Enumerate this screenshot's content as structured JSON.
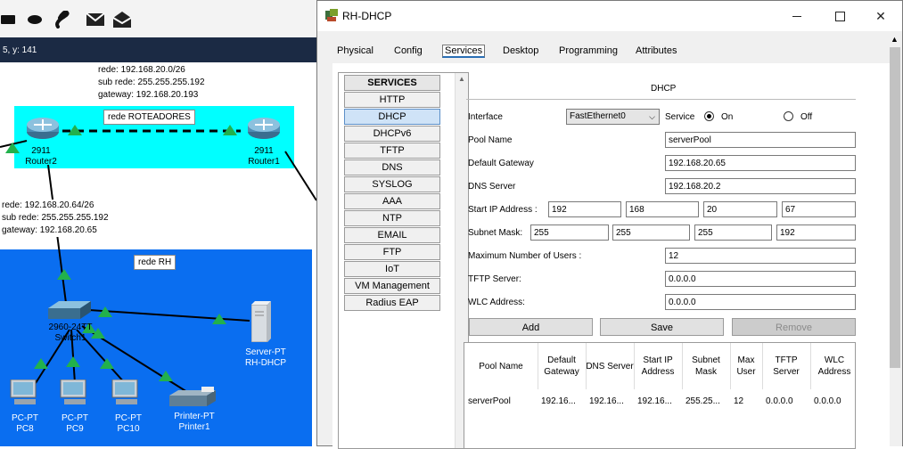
{
  "status_coords": "5, y: 141",
  "workspace": {
    "note_top": [
      "rede: 192.168.20.0/26",
      "sub rede: 255.255.255.192",
      "gateway: 192.168.20.193"
    ],
    "note_mid": [
      "rede: 192.168.20.64/26",
      "sub rede: 255.255.255.192",
      "gateway: 192.168.20.65"
    ],
    "area_routers": "rede ROTEADORES",
    "area_rh": "rede RH",
    "router2": [
      "2911",
      "Router2"
    ],
    "router1": [
      "2911",
      "Router1"
    ],
    "switch": [
      "2960-24TT",
      "Switch1"
    ],
    "server": [
      "Server-PT",
      "RH-DHCP"
    ],
    "pc8": [
      "PC-PT",
      "PC8"
    ],
    "pc9": [
      "PC-PT",
      "PC9"
    ],
    "pc10": [
      "PC-PT",
      "PC10"
    ],
    "printer": [
      "Printer-PT",
      "Printer1"
    ]
  },
  "window": {
    "title": "RH-DHCP",
    "tabs": [
      "Physical",
      "Config",
      "Services",
      "Desktop",
      "Programming",
      "Attributes"
    ],
    "active_tab": "Services"
  },
  "services": {
    "header": "SERVICES",
    "items": [
      "HTTP",
      "DHCP",
      "DHCPv6",
      "TFTP",
      "DNS",
      "SYSLOG",
      "AAA",
      "NTP",
      "EMAIL",
      "FTP",
      "IoT",
      "VM Management",
      "Radius EAP"
    ],
    "selected": "DHCP"
  },
  "dhcp": {
    "heading": "DHCP",
    "interface_label": "Interface",
    "interface_value": "FastEthernet0",
    "service_label": "Service",
    "on_label": "On",
    "off_label": "Off",
    "pool_name_label": "Pool Name",
    "pool_name_value": "serverPool",
    "default_gateway_label": "Default Gateway",
    "default_gateway_value": "192.168.20.65",
    "dns_label": "DNS Server",
    "dns_value": "192.168.20.2",
    "start_ip_label": "Start IP Address :",
    "start_ip": [
      "192",
      "168",
      "20",
      "67"
    ],
    "subnet_label": "Subnet Mask:",
    "subnet": [
      "255",
      "255",
      "255",
      "192"
    ],
    "max_users_label": "Maximum Number of Users :",
    "max_users_value": "12",
    "tftp_label": "TFTP Server:",
    "tftp_value": "0.0.0.0",
    "wlc_label": "WLC Address:",
    "wlc_value": "0.0.0.0",
    "add_label": "Add",
    "save_label": "Save",
    "remove_label": "Remove",
    "table": {
      "headers": [
        "Pool Name",
        "Default Gateway",
        "DNS Server",
        "Start IP Address",
        "Subnet Mask",
        "Max User",
        "TFTP Server",
        "WLC Address"
      ],
      "row": [
        "serverPool",
        "192.16...",
        "192.16...",
        "192.16...",
        "255.25...",
        "12",
        "0.0.0.0",
        "0.0.0.0"
      ]
    }
  },
  "colors": {
    "status_bar": "#1b2a44",
    "router_area": "#00ffff",
    "rh_area": "#0a6ef0",
    "link": "#22b14c"
  }
}
